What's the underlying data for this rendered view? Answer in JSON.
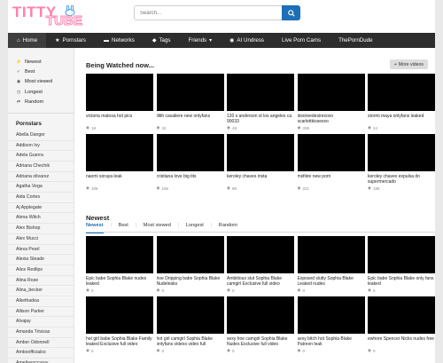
{
  "logo": {
    "text_top": "TITTY",
    "text_bottom": "TUBE",
    "alt": "Tittytube"
  },
  "search": {
    "placeholder": "Search..."
  },
  "nav": [
    {
      "label": "Home",
      "icon": "home-icon",
      "active": true
    },
    {
      "label": "Pornstars",
      "icon": "star-icon"
    },
    {
      "label": "Networks",
      "icon": "folder-icon"
    },
    {
      "label": "Tags",
      "icon": "tag-icon"
    },
    {
      "label": "Friends",
      "icon": "caret-down-icon"
    },
    {
      "label": "AI Undress",
      "icon": "ai-icon"
    },
    {
      "label": "Live Porn Cams",
      "icon": ""
    },
    {
      "label": "ThePornDude",
      "icon": ""
    }
  ],
  "sort": [
    {
      "label": "Newest",
      "icon": "bolt-icon"
    },
    {
      "label": "Best",
      "icon": "thumbs-up-icon"
    },
    {
      "label": "Most viewed",
      "icon": "eye-icon"
    },
    {
      "label": "Longest",
      "icon": "clock-icon"
    },
    {
      "label": "Random",
      "icon": "shuffle-icon"
    }
  ],
  "pornstars": {
    "title": "Pornstars",
    "items": [
      "Abella Danger",
      "Addison Ivy",
      "Adela Guerra",
      "Adriana Chechik",
      "Adriana olivarez",
      "Agatha Vega",
      "Aida Cortes",
      "Aj Applegate",
      "Alena Witch",
      "Alex Bishop",
      "Alex Mucci",
      "Alexa Pearl",
      "Alexia Steade",
      "Alice Redlips",
      "Alina Rose",
      "Alina_becker",
      "Alkethadea",
      "Allison Parker",
      "Alvajay",
      "Amanda Trivizas",
      "Amber Odonnell",
      "Amboofficialxo",
      "Ameliasoccurvy"
    ]
  },
  "watched": {
    "title": "Being Watched now...",
    "more": "More videos",
    "videos": [
      {
        "title": "victoria matosa hot pics",
        "views": "19"
      },
      {
        "title": "lilith cavaliere new onlyfans",
        "views": "42"
      },
      {
        "title": "120 s anderson st los angeles ca 90033",
        "views": "49"
      },
      {
        "title": "desireedesirexoxo scarlettkissesxo",
        "views": "338"
      },
      {
        "title": "stormi maya onlyfans leaked",
        "views": "24"
      },
      {
        "title": "naomi soraya leak",
        "views": "108"
      },
      {
        "title": "cristiana love big tits",
        "views": "156"
      },
      {
        "title": "keroley chaves insta",
        "views": "89"
      },
      {
        "title": "msfiiire new porn",
        "views": "221"
      },
      {
        "title": "keroley chaves expulsa do supermercado",
        "views": "185"
      }
    ]
  },
  "newest": {
    "title": "Newest",
    "tabs": [
      "Newest",
      "Best",
      "Most viewed",
      "Longest",
      "Random"
    ],
    "videos": [
      {
        "title": "Epic babe Sophia Blake nudes leaked",
        "views": "0"
      },
      {
        "title": "hoe Dripping babe Sophia Blake Nudeleaks",
        "views": "0"
      },
      {
        "title": "Ambitious slut Sophia Blake camgirl Exclusive full video",
        "views": "0"
      },
      {
        "title": "Exposed slutty Sophia Blake Leaked nudes",
        "views": "0"
      },
      {
        "title": "Epic babe Sophia Blake only fans leaked",
        "views": "0"
      },
      {
        "title": "hot girl babe Sophia Blake Family leaked Exclusive full video",
        "views": "0"
      },
      {
        "title": "hot girl camgirl Sophia Blake onlyfans videos video full",
        "views": "0"
      },
      {
        "title": "sexy hoe camgirl Sophia Blake Nudes Exclusive full video",
        "views": "0"
      },
      {
        "title": "sexy bitch hot Sophia Blake Patreon leak",
        "views": "0"
      },
      {
        "title": "ewhore Spencer Nicks nudes free",
        "views": "0"
      }
    ]
  },
  "colors": {
    "accent": "#1d6fb8",
    "nav_bg": "#2d2d2d",
    "logo_pink": "#ff7fae"
  }
}
